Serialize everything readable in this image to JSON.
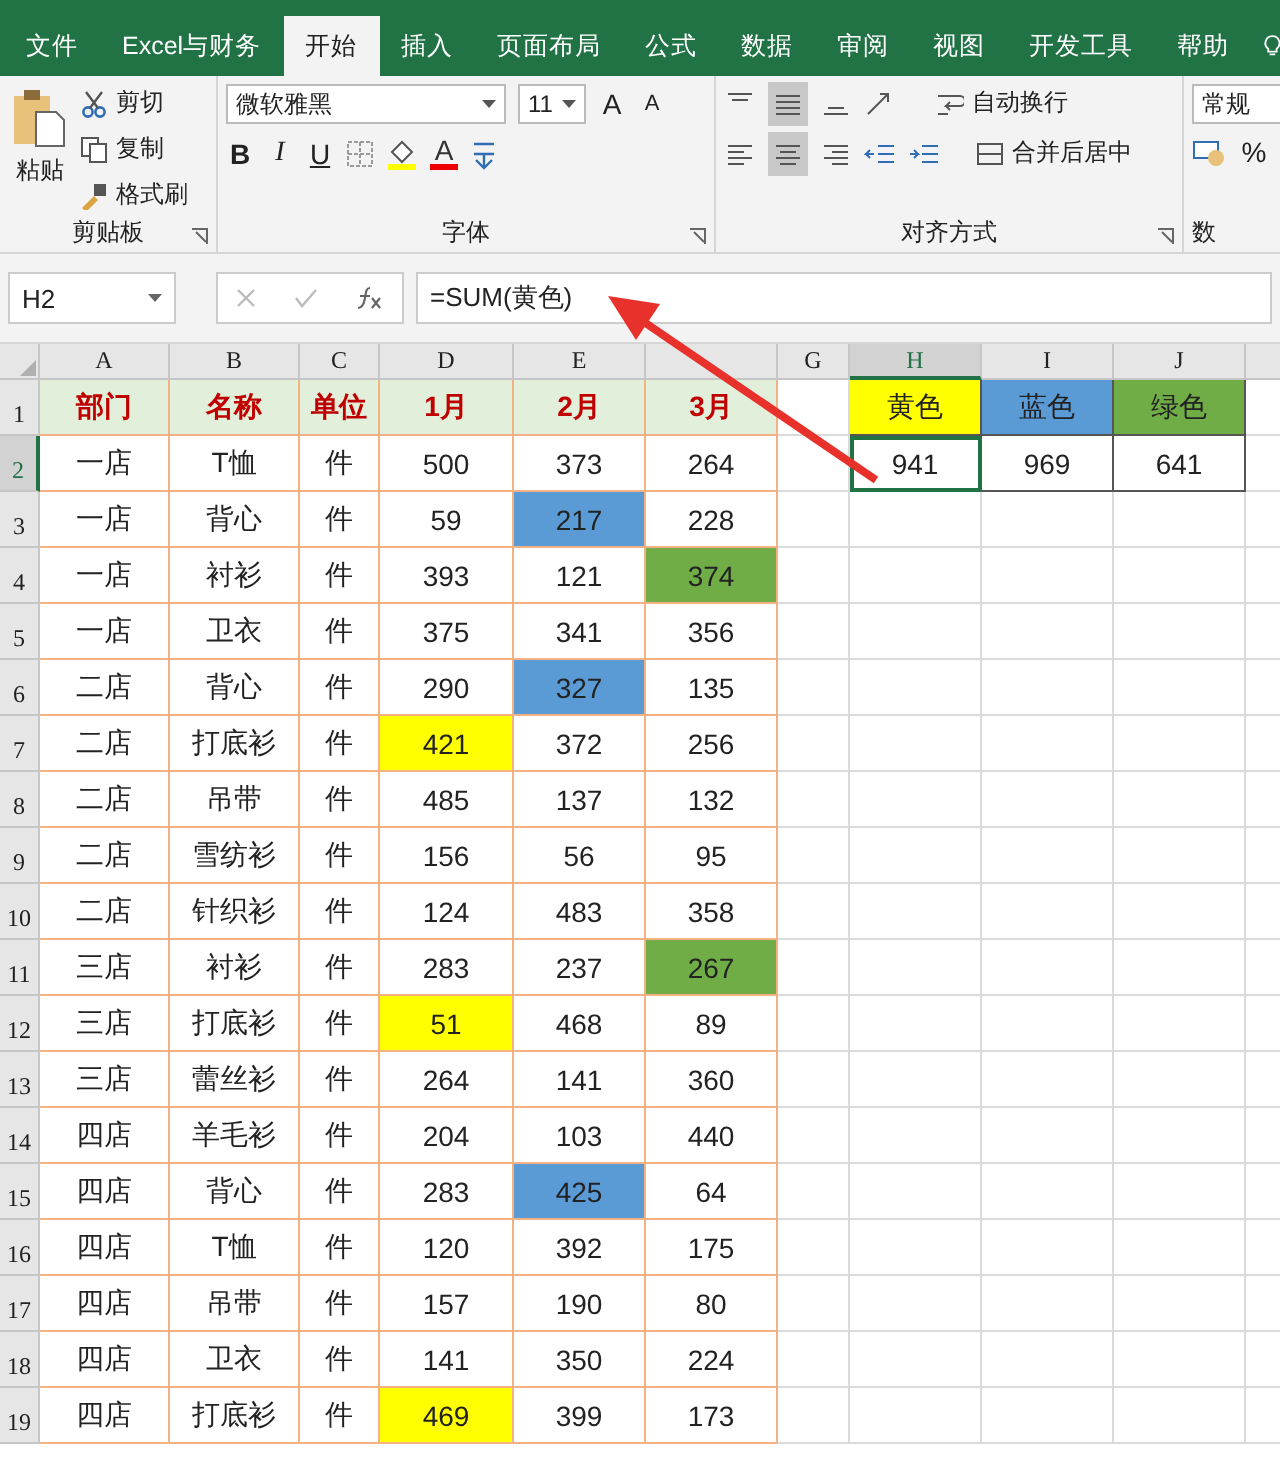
{
  "tabs": [
    {
      "label": "文件",
      "selected": false
    },
    {
      "label": "Excel与财务",
      "selected": false
    },
    {
      "label": "开始",
      "selected": true
    },
    {
      "label": "插入",
      "selected": false
    },
    {
      "label": "页面布局",
      "selected": false
    },
    {
      "label": "公式",
      "selected": false
    },
    {
      "label": "数据",
      "selected": false
    },
    {
      "label": "审阅",
      "selected": false
    },
    {
      "label": "视图",
      "selected": false
    },
    {
      "label": "开发工具",
      "selected": false
    },
    {
      "label": "帮助",
      "selected": false
    }
  ],
  "ribbon": {
    "clipboard": {
      "paste": "粘贴",
      "cut": "剪切",
      "copy": "复制",
      "format_painter": "格式刷",
      "label": "剪贴板"
    },
    "font": {
      "font_name": "微软雅黑",
      "font_size": "11",
      "grow": "A",
      "shrink": "A",
      "bold": "B",
      "italic": "I",
      "underline": "U",
      "font_color": "A",
      "label": "字体"
    },
    "alignment": {
      "wrap_text": "自动换行",
      "merge_center": "合并后居中",
      "label": "对齐方式"
    },
    "number": {
      "format": "常规",
      "percent": "%",
      "label": "数"
    }
  },
  "formula_bar": {
    "name_box": "H2",
    "formula": "=SUM(黄色)"
  },
  "columns": [
    {
      "letter": "A",
      "selected": false
    },
    {
      "letter": "B",
      "selected": false
    },
    {
      "letter": "C",
      "selected": false
    },
    {
      "letter": "D",
      "selected": false
    },
    {
      "letter": "E",
      "selected": false
    },
    {
      "selected": false
    },
    {
      "letter": "G",
      "selected": false
    },
    {
      "letter": "H",
      "selected": true
    },
    {
      "letter": "I",
      "selected": false
    },
    {
      "letter": "J",
      "selected": false
    }
  ],
  "row_numbers": [
    {
      "label": "1",
      "selected": false
    },
    {
      "label": "2",
      "selected": true
    },
    {
      "label": "3",
      "selected": false
    },
    {
      "label": "4",
      "selected": false
    },
    {
      "label": "5",
      "selected": false
    },
    {
      "label": "6",
      "selected": false
    },
    {
      "label": "7",
      "selected": false
    },
    {
      "label": "8",
      "selected": false
    },
    {
      "label": "9",
      "selected": false
    },
    {
      "label": "10",
      "selected": false
    },
    {
      "label": "11",
      "selected": false
    },
    {
      "label": "12",
      "selected": false
    },
    {
      "label": "13",
      "selected": false
    },
    {
      "label": "14",
      "selected": false
    },
    {
      "label": "15",
      "selected": false
    },
    {
      "label": "16",
      "selected": false
    },
    {
      "label": "17",
      "selected": false
    },
    {
      "label": "18",
      "selected": false
    },
    {
      "label": "19",
      "selected": false
    }
  ],
  "table": {
    "headers": [
      "部门",
      "名称",
      "单位",
      "1月",
      "2月",
      "3月"
    ],
    "rows": [
      {
        "cells": [
          {
            "text": "一店"
          },
          {
            "text": "T恤"
          },
          {
            "text": "件"
          },
          {
            "text": "500"
          },
          {
            "text": "373"
          },
          {
            "text": "264"
          }
        ]
      },
      {
        "cells": [
          {
            "text": "一店"
          },
          {
            "text": "背心"
          },
          {
            "text": "件"
          },
          {
            "text": "59"
          },
          {
            "text": "217",
            "color": "#5b9bd5"
          },
          {
            "text": "228"
          }
        ]
      },
      {
        "cells": [
          {
            "text": "一店"
          },
          {
            "text": "衬衫"
          },
          {
            "text": "件"
          },
          {
            "text": "393"
          },
          {
            "text": "121"
          },
          {
            "text": "374",
            "color": "#70ad47"
          }
        ]
      },
      {
        "cells": [
          {
            "text": "一店"
          },
          {
            "text": "卫衣"
          },
          {
            "text": "件"
          },
          {
            "text": "375"
          },
          {
            "text": "341"
          },
          {
            "text": "356"
          }
        ]
      },
      {
        "cells": [
          {
            "text": "二店"
          },
          {
            "text": "背心"
          },
          {
            "text": "件"
          },
          {
            "text": "290"
          },
          {
            "text": "327",
            "color": "#5b9bd5"
          },
          {
            "text": "135"
          }
        ]
      },
      {
        "cells": [
          {
            "text": "二店"
          },
          {
            "text": "打底衫"
          },
          {
            "text": "件"
          },
          {
            "text": "421",
            "color": "#ffff00"
          },
          {
            "text": "372"
          },
          {
            "text": "256"
          }
        ]
      },
      {
        "cells": [
          {
            "text": "二店"
          },
          {
            "text": "吊带"
          },
          {
            "text": "件"
          },
          {
            "text": "485"
          },
          {
            "text": "137"
          },
          {
            "text": "132"
          }
        ]
      },
      {
        "cells": [
          {
            "text": "二店"
          },
          {
            "text": "雪纺衫"
          },
          {
            "text": "件"
          },
          {
            "text": "156"
          },
          {
            "text": "56"
          },
          {
            "text": "95"
          }
        ]
      },
      {
        "cells": [
          {
            "text": "二店"
          },
          {
            "text": "针织衫"
          },
          {
            "text": "件"
          },
          {
            "text": "124"
          },
          {
            "text": "483"
          },
          {
            "text": "358"
          }
        ]
      },
      {
        "cells": [
          {
            "text": "三店"
          },
          {
            "text": "衬衫"
          },
          {
            "text": "件"
          },
          {
            "text": "283"
          },
          {
            "text": "237"
          },
          {
            "text": "267",
            "color": "#70ad47"
          }
        ]
      },
      {
        "cells": [
          {
            "text": "三店"
          },
          {
            "text": "打底衫"
          },
          {
            "text": "件"
          },
          {
            "text": "51",
            "color": "#ffff00"
          },
          {
            "text": "468"
          },
          {
            "text": "89"
          }
        ]
      },
      {
        "cells": [
          {
            "text": "三店"
          },
          {
            "text": "蕾丝衫"
          },
          {
            "text": "件"
          },
          {
            "text": "264"
          },
          {
            "text": "141"
          },
          {
            "text": "360"
          }
        ]
      },
      {
        "cells": [
          {
            "text": "四店"
          },
          {
            "text": "羊毛衫"
          },
          {
            "text": "件"
          },
          {
            "text": "204"
          },
          {
            "text": "103"
          },
          {
            "text": "440"
          }
        ]
      },
      {
        "cells": [
          {
            "text": "四店"
          },
          {
            "text": "背心"
          },
          {
            "text": "件"
          },
          {
            "text": "283"
          },
          {
            "text": "425",
            "color": "#5b9bd5"
          },
          {
            "text": "64"
          }
        ]
      },
      {
        "cells": [
          {
            "text": "四店"
          },
          {
            "text": "T恤"
          },
          {
            "text": "件"
          },
          {
            "text": "120"
          },
          {
            "text": "392"
          },
          {
            "text": "175"
          }
        ]
      },
      {
        "cells": [
          {
            "text": "四店"
          },
          {
            "text": "吊带"
          },
          {
            "text": "件"
          },
          {
            "text": "157"
          },
          {
            "text": "190"
          },
          {
            "text": "80"
          }
        ]
      },
      {
        "cells": [
          {
            "text": "四店"
          },
          {
            "text": "卫衣"
          },
          {
            "text": "件"
          },
          {
            "text": "141"
          },
          {
            "text": "350"
          },
          {
            "text": "224"
          }
        ]
      },
      {
        "cells": [
          {
            "text": "四店"
          },
          {
            "text": "打底衫"
          },
          {
            "text": "件"
          },
          {
            "text": "469",
            "color": "#ffff00"
          },
          {
            "text": "399"
          },
          {
            "text": "173"
          }
        ]
      }
    ]
  },
  "summary": {
    "headers": [
      {
        "text": "黄色",
        "color": "#ffff00"
      },
      {
        "text": "蓝色",
        "color": "#5b9bd5"
      },
      {
        "text": "绿色",
        "color": "#70ad47"
      }
    ],
    "values": [
      {
        "text": "941",
        "selected": true
      },
      {
        "text": "969",
        "selected": false
      },
      {
        "text": "641",
        "selected": false
      }
    ]
  }
}
